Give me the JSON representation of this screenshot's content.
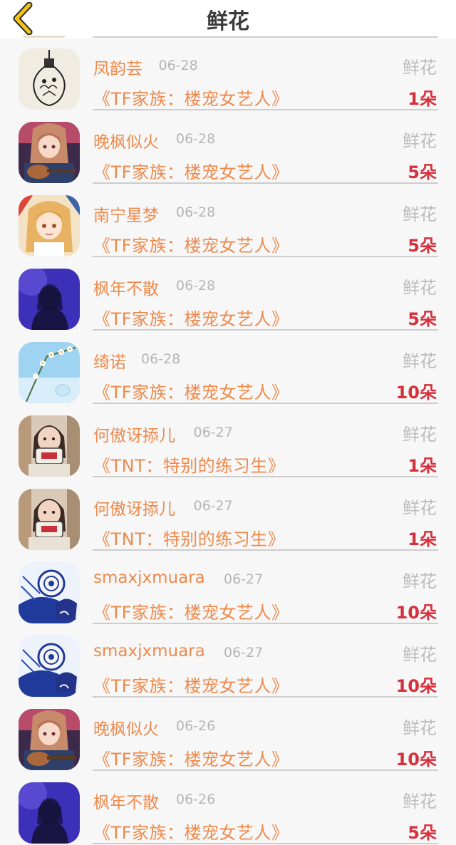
{
  "header": {
    "title": "鲜花"
  },
  "records": [
    {
      "name": "凤韵芸",
      "date": "06-28",
      "type": "鲜花",
      "book": "《TF家族：楼宠女艺人》",
      "count": "1朵",
      "avatar": "bulb"
    },
    {
      "name": "晚枫似火",
      "date": "06-28",
      "type": "鲜花",
      "book": "《TF家族：楼宠女艺人》",
      "count": "5朵",
      "avatar": "anime-guitar"
    },
    {
      "name": "南宁星梦",
      "date": "06-28",
      "type": "鲜花",
      "book": "《TF家族：楼宠女艺人》",
      "count": "5朵",
      "avatar": "anime-blonde"
    },
    {
      "name": "枫年不散",
      "date": "06-28",
      "type": "鲜花",
      "book": "《TF家族：楼宠女艺人》",
      "count": "5朵",
      "avatar": "purple-silhouette"
    },
    {
      "name": "绮诺",
      "date": "06-28",
      "type": "鲜花",
      "book": "《TF家族：楼宠女艺人》",
      "count": "10朵",
      "avatar": "flowers-sky"
    },
    {
      "name": "何傲讶掭儿",
      "date": "06-27",
      "type": "鲜花",
      "book": "《TNT：特别的练习生》",
      "count": "1朵",
      "avatar": "girl-photo"
    },
    {
      "name": "何傲讶掭儿",
      "date": "06-27",
      "type": "鲜花",
      "book": "《TNT：特别的练习生》",
      "count": "1朵",
      "avatar": "girl-photo"
    },
    {
      "name": "smaxjxmuara",
      "date": "06-27",
      "type": "鲜花",
      "book": "《TF家族：楼宠女艺人》",
      "count": "10朵",
      "avatar": "blue-mask"
    },
    {
      "name": "smaxjxmuara",
      "date": "06-27",
      "type": "鲜花",
      "book": "《TF家族：楼宠女艺人》",
      "count": "10朵",
      "avatar": "blue-mask"
    },
    {
      "name": "晚枫似火",
      "date": "06-26",
      "type": "鲜花",
      "book": "《TF家族：楼宠女艺人》",
      "count": "10朵",
      "avatar": "anime-guitar"
    },
    {
      "name": "枫年不散",
      "date": "06-26",
      "type": "鲜花",
      "book": "《TF家族：楼宠女艺人》",
      "count": "5朵",
      "avatar": "purple-silhouette"
    }
  ],
  "colors": {
    "accent": "#ef8a4c",
    "count": "#d6303c",
    "muted": "#b5b5b5",
    "back_icon": "#f2c418"
  },
  "icons": {
    "back": "chevron-left-icon"
  }
}
